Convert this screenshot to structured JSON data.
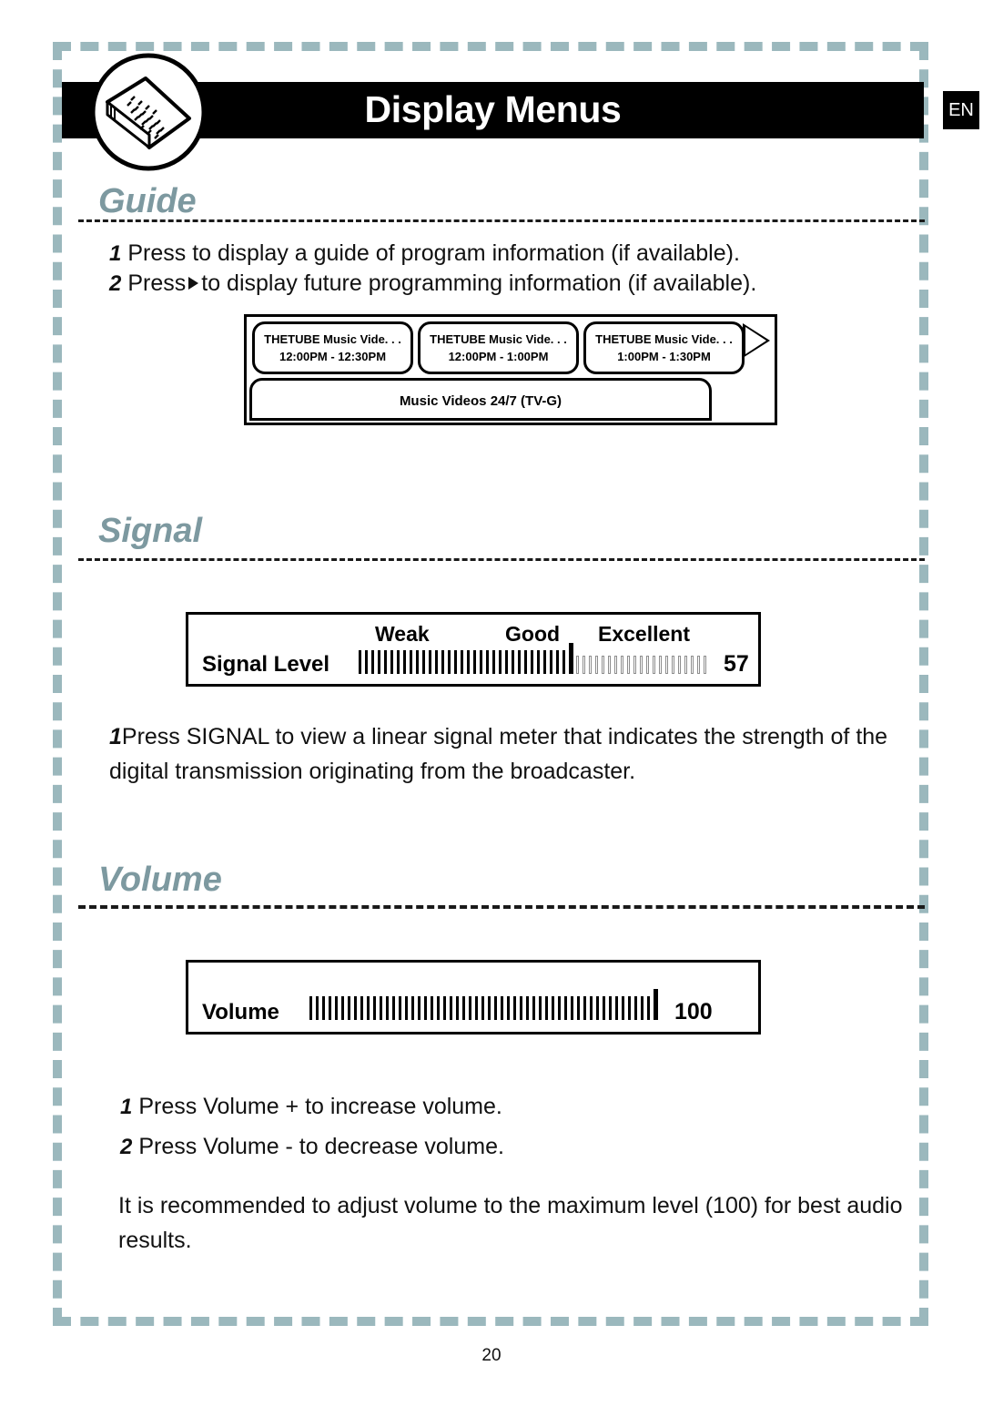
{
  "header": {
    "title": "Display Menus",
    "language_badge": "EN",
    "icon": "open-book-icon"
  },
  "sections": [
    {
      "id": "guide",
      "heading": "Guide",
      "steps": [
        {
          "num": "1",
          "text": "Press to display a guide of program information (if available)."
        },
        {
          "num": "2",
          "text_before": "Press",
          "icon": "right-triangle-icon",
          "text_after": "to display future programming information (if available)."
        }
      ]
    },
    {
      "id": "signal",
      "heading": "Signal",
      "steps": [
        {
          "num": "1",
          "text": "Press SIGNAL to view a linear signal meter that indicates the strength of the digital transmission originating from the broadcaster."
        }
      ]
    },
    {
      "id": "volume",
      "heading": "Volume",
      "steps": [
        {
          "num": "1",
          "text": "Press Volume  +  to increase volume."
        },
        {
          "num": "2",
          "text": "Press Volume  -  to decrease volume."
        }
      ],
      "note": "It is recommended to adjust volume to the maximum level (100) for best audio results."
    }
  ],
  "guide_mockup": {
    "cells": [
      {
        "title": "THETUBE Music Vide. . .",
        "time": "12:00PM - 12:30PM"
      },
      {
        "title": "THETUBE Music Vide. . .",
        "time": "12:00PM - 1:00PM"
      },
      {
        "title": "THETUBE Music Vide. . .",
        "time": "1:00PM - 1:30PM"
      }
    ],
    "arrow": "next-page-arrow-icon",
    "detail_bar": "Music Videos 24/7 (TV-G)"
  },
  "signal_meter": {
    "label": "Signal Level",
    "scale": [
      "Weak",
      "Good",
      "Excellent"
    ],
    "value": "57",
    "filled_bars": 33,
    "empty_bars": 21,
    "max": 100
  },
  "volume_meter": {
    "label": "Volume",
    "value": "100",
    "filled_bars": 54,
    "empty_bars": 0,
    "max": 100
  },
  "footer": {
    "page_number": "20"
  },
  "colors": {
    "heading": "#7d99a0",
    "frame_dash": "#9bb8bd",
    "band": "#000000",
    "text": "#111111"
  }
}
